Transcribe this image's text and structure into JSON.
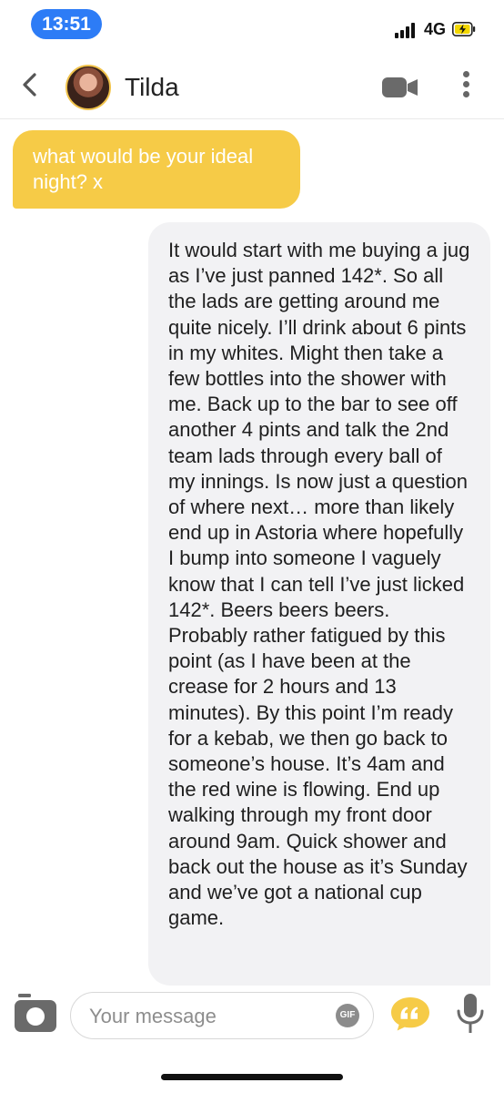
{
  "status_bar": {
    "time": "13:51",
    "network": "4G",
    "accent": "#2d7cf6"
  },
  "header": {
    "back_icon": "chevron-left-icon",
    "contact_name": "Tilda",
    "video_icon": "video-camera-icon",
    "more_icon": "vertical-dots-icon"
  },
  "messages": [
    {
      "direction": "incoming",
      "color": "#f6cb47",
      "text": "what would be your ideal night? x"
    },
    {
      "direction": "outgoing",
      "color": "#f2f2f4",
      "text": "It would start with me buying a jug as I’ve just panned 142*. So all the lads are getting around me quite nicely. I’ll drink about 6 pints in my whites. Might then take a few bottles into the shower with me. Back up to the bar to see off another 4 pints and talk the 2nd team lads through every ball of my innings. Is now just a question of where next… more than likely end up in Astoria where hopefully I bump into someone I vaguely know that I can tell I’ve just licked 142*. Beers beers beers. Probably rather fatigued by this point (as I have been at the crease for 2 hours and 13 minutes). By this point I’m ready for a kebab, we then go back to someone’s house. It’s 4am and the red wine is flowing. End up walking through my front door around 9am. Quick shower and back out the house as it’s Sunday and we’ve got a national cup game."
    }
  ],
  "composer": {
    "placeholder": "Your message",
    "value": "",
    "gif_label": "GIF",
    "camera_icon": "camera-icon",
    "quote_icon": "quote-bubble-icon",
    "mic_icon": "microphone-icon",
    "quote_color": "#f6cb47"
  }
}
